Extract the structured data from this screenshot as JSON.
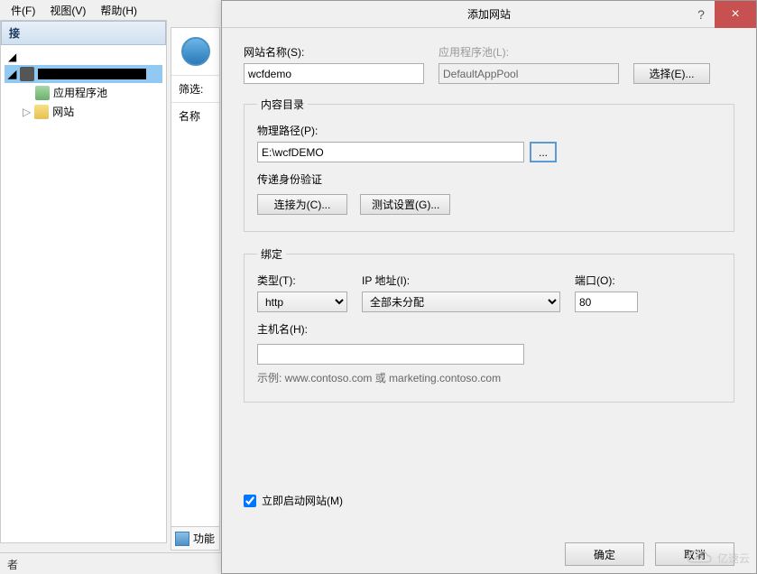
{
  "menubar": {
    "file": "件(F)",
    "view": "视图(V)",
    "help": "帮助(H)"
  },
  "left_panel": {
    "header": "接",
    "tree": {
      "root_caret": "◢",
      "server_prefix": "◢",
      "server_redacted": "",
      "app_pools": "应用程序池",
      "sites": "网站"
    }
  },
  "mid_panel": {
    "filter": "筛选:",
    "name": "名称"
  },
  "dialog": {
    "title": "添加网站",
    "help": "?",
    "close": "×",
    "site_name_label": "网站名称(S):",
    "site_name_value": "wcfdemo",
    "app_pool_label": "应用程序池(L):",
    "app_pool_value": "DefaultAppPool",
    "select_btn": "选择(E)...",
    "content_dir": {
      "legend": "内容目录",
      "physical_path_label": "物理路径(P):",
      "physical_path_value": "E:\\wcfDEMO",
      "browse": "...",
      "auth_label": "传递身份验证",
      "connect_as": "连接为(C)...",
      "test_settings": "测试设置(G)..."
    },
    "binding": {
      "legend": "绑定",
      "type_label": "类型(T):",
      "type_value": "http",
      "ip_label": "IP 地址(I):",
      "ip_value": "全部未分配",
      "port_label": "端口(O):",
      "port_value": "80",
      "hostname_label": "主机名(H):",
      "hostname_value": "",
      "example": "示例: www.contoso.com 或 marketing.contoso.com"
    },
    "start_immediately": "立即启动网站(M)",
    "ok": "确定",
    "cancel": "取消"
  },
  "bottom": {
    "ready": "者",
    "func": "功能"
  },
  "watermark": "亿速云"
}
